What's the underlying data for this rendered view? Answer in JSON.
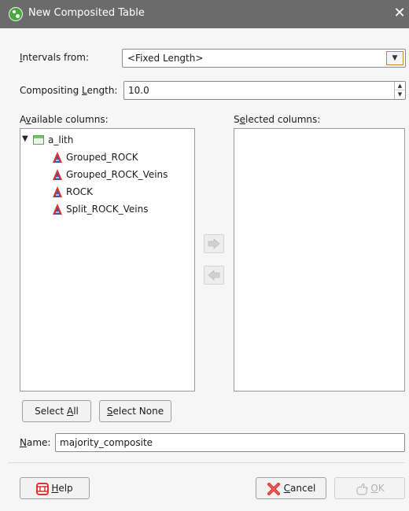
{
  "window": {
    "title": "New Composited Table",
    "close_symbol": "✕"
  },
  "intervals": {
    "label_pre": "",
    "label_key": "I",
    "label_post": "ntervals from:",
    "value": "<Fixed Length>"
  },
  "compositing": {
    "label_pre": "Compositing ",
    "label_key": "L",
    "label_post": "ength:",
    "value": "10.0"
  },
  "available": {
    "label_pre": "A",
    "label_key": "v",
    "label_post": "ailable columns:",
    "tree": {
      "root": "a_lith",
      "children": [
        "Grouped_ROCK",
        "Grouped_ROCK_Veins",
        "ROCK",
        "Split_ROCK_Veins"
      ]
    }
  },
  "selected": {
    "label_pre": "S",
    "label_key": "e",
    "label_post": "lected columns:"
  },
  "buttons": {
    "select_all_pre": "Select ",
    "select_all_key": "A",
    "select_all_post": "ll",
    "select_none_pre": "",
    "select_none_key": "S",
    "select_none_post": "elect None",
    "help_key": "H",
    "help_post": "elp",
    "cancel_key": "C",
    "cancel_post": "ancel",
    "ok_key": "O",
    "ok_post": "K"
  },
  "name": {
    "label_key": "N",
    "label_post": "ame:",
    "value": "majority_composite"
  },
  "icons": {
    "app": "leapfrog-app-icon",
    "table": "table-icon",
    "column": "category-column-icon",
    "add": "arrow-right-icon",
    "remove": "arrow-left-icon",
    "help": "lifebuoy-icon",
    "cancel": "red-x-icon",
    "ok": "ok-hand-icon"
  },
  "colors": {
    "titlebar": "#6b6b6b",
    "accent_border": "#c08a30",
    "column_icon_red": "#d9312b",
    "column_icon_blue": "#2f5fb3"
  }
}
